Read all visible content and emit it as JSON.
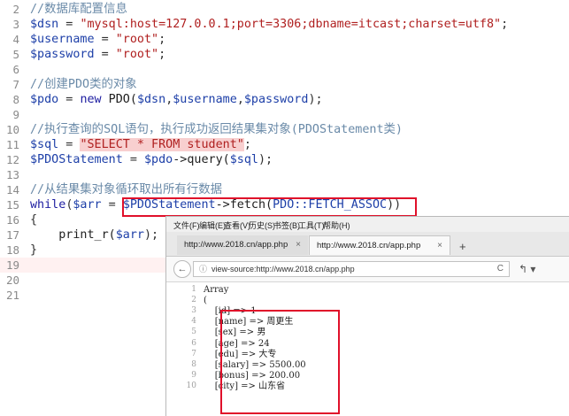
{
  "editor": {
    "lines": [
      {
        "n": "2",
        "parts": [
          {
            "t": "//数据库配置信息",
            "c": "comment"
          }
        ]
      },
      {
        "n": "3",
        "parts": [
          {
            "t": "$dsn",
            "c": "var"
          },
          {
            "t": " = ",
            "c": "op"
          },
          {
            "t": "\"mysql:host=127.0.0.1;port=3306;dbname=itcast;charset=utf8\"",
            "c": "str"
          },
          {
            "t": ";",
            "c": "op"
          }
        ]
      },
      {
        "n": "4",
        "parts": [
          {
            "t": "$username",
            "c": "var"
          },
          {
            "t": " = ",
            "c": "op"
          },
          {
            "t": "\"root\"",
            "c": "str"
          },
          {
            "t": ";",
            "c": "op"
          }
        ]
      },
      {
        "n": "5",
        "parts": [
          {
            "t": "$password",
            "c": "var"
          },
          {
            "t": " = ",
            "c": "op"
          },
          {
            "t": "\"root\"",
            "c": "str"
          },
          {
            "t": ";",
            "c": "op"
          }
        ]
      },
      {
        "n": "6",
        "parts": []
      },
      {
        "n": "7",
        "parts": [
          {
            "t": "//创建PDO类的对象",
            "c": "comment"
          }
        ]
      },
      {
        "n": "8",
        "parts": [
          {
            "t": "$pdo",
            "c": "var"
          },
          {
            "t": " = ",
            "c": "op"
          },
          {
            "t": "new",
            "c": "kw"
          },
          {
            "t": " PDO(",
            "c": "fn"
          },
          {
            "t": "$dsn",
            "c": "var"
          },
          {
            "t": ",",
            "c": "op"
          },
          {
            "t": "$username",
            "c": "var"
          },
          {
            "t": ",",
            "c": "op"
          },
          {
            "t": "$password",
            "c": "var"
          },
          {
            "t": ");",
            "c": "op"
          }
        ]
      },
      {
        "n": "9",
        "parts": []
      },
      {
        "n": "10",
        "parts": [
          {
            "t": "//执行查询的SQL语句，执行成功返回结果集对象(PDOStatement类)",
            "c": "comment"
          }
        ]
      },
      {
        "n": "11",
        "parts": [
          {
            "t": "$sql",
            "c": "var"
          },
          {
            "t": " = ",
            "c": "op"
          },
          {
            "t": "\"SELECT * FROM student\"",
            "c": "str hl-sql"
          },
          {
            "t": ";",
            "c": "op"
          }
        ]
      },
      {
        "n": "12",
        "parts": [
          {
            "t": "$PDOStatement",
            "c": "var"
          },
          {
            "t": " = ",
            "c": "op"
          },
          {
            "t": "$pdo",
            "c": "var"
          },
          {
            "t": "->query(",
            "c": "fn"
          },
          {
            "t": "$sql",
            "c": "var"
          },
          {
            "t": ");",
            "c": "op"
          }
        ]
      },
      {
        "n": "13",
        "parts": []
      },
      {
        "n": "14",
        "parts": [
          {
            "t": "//从结果集对象循环取出所有行数据",
            "c": "comment"
          }
        ]
      },
      {
        "n": "15",
        "parts": [
          {
            "t": "while",
            "c": "kw"
          },
          {
            "t": "(",
            "c": "op"
          },
          {
            "t": "$arr",
            "c": "var"
          },
          {
            "t": " = ",
            "c": "op"
          },
          {
            "t": "$PDOStatement",
            "c": "var"
          },
          {
            "t": "->fetch(",
            "c": "fn"
          },
          {
            "t": "PDO::FETCH_ASSOC",
            "c": "cls"
          },
          {
            "t": "))",
            "c": "op"
          }
        ]
      },
      {
        "n": "16",
        "parts": [
          {
            "t": "{",
            "c": "op"
          }
        ]
      },
      {
        "n": "17",
        "parts": [
          {
            "t": "    print_r(",
            "c": "fn"
          },
          {
            "t": "$arr",
            "c": "var"
          },
          {
            "t": ");",
            "c": "op"
          }
        ]
      },
      {
        "n": "18",
        "parts": [
          {
            "t": "}",
            "c": "op"
          }
        ]
      },
      {
        "n": "19",
        "parts": [],
        "highlight": true
      },
      {
        "n": "20",
        "parts": []
      },
      {
        "n": "21",
        "parts": []
      }
    ]
  },
  "browser": {
    "menu": [
      "文件(F)",
      "编辑(E)",
      "查看(V)",
      "历史(S)",
      "书签(B)",
      "工具(T)",
      "帮助(H)"
    ],
    "tabs": [
      {
        "label": "http://www.2018.cn/app.php",
        "close": "×"
      },
      {
        "label": "http://www.2018.cn/app.php",
        "close": "×"
      }
    ],
    "new_tab": "+",
    "back": "←",
    "address": "view-source:http://www.2018.cn/app.php",
    "info_icon": "ⓘ",
    "reload": "C",
    "nav_icons": "↰ ▾",
    "source_lines": [
      {
        "n": "1",
        "t": "Array"
      },
      {
        "n": "2",
        "t": "("
      },
      {
        "n": "3",
        "t": "    [id] => 1"
      },
      {
        "n": "4",
        "t": "    [name] => 周更生"
      },
      {
        "n": "5",
        "t": "    [sex] => 男"
      },
      {
        "n": "6",
        "t": "    [age] => 24"
      },
      {
        "n": "7",
        "t": "    [edu] => 大专"
      },
      {
        "n": "8",
        "t": "    [salary] => 5500.00"
      },
      {
        "n": "9",
        "t": "    [bonus] => 200.00"
      },
      {
        "n": "10",
        "t": "    [city] => 山东省"
      }
    ]
  },
  "colors": {
    "annotation_box": "#e0102a",
    "string": "#b02020",
    "variable": "#1d3fa8",
    "comment": "#6a8aa8"
  }
}
